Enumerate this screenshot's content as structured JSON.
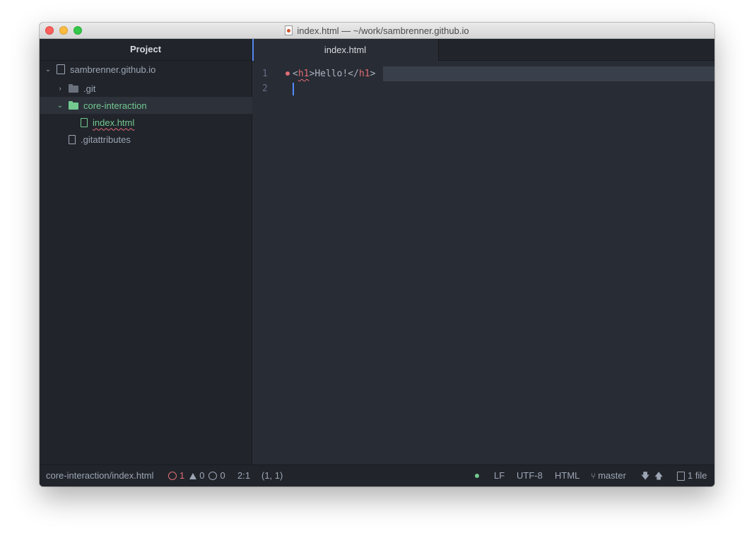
{
  "window": {
    "title": "index.html — ~/work/sambrenner.github.io"
  },
  "sidebar": {
    "header": "Project",
    "root": "sambrenner.github.io",
    "items": [
      {
        "label": ".git",
        "type": "folder",
        "expanded": false
      },
      {
        "label": "core-interaction",
        "type": "folder",
        "expanded": true
      },
      {
        "label": "index.html",
        "type": "file",
        "parent": "core-interaction"
      },
      {
        "label": ".gitattributes",
        "type": "file"
      }
    ]
  },
  "editor": {
    "tab_label": "index.html",
    "lines": [
      {
        "number": "1",
        "open_bracket": "<",
        "open_tag": "h1",
        "close_bracket": ">",
        "text": "Hello!",
        "close_open": "</",
        "close_tag": "h1",
        "close_end": ">"
      },
      {
        "number": "2"
      }
    ]
  },
  "status": {
    "path": "core-interaction/index.html",
    "errors": "1",
    "warnings": "0",
    "infos": "0",
    "cursor": "2:1",
    "selection": "(1, 1)",
    "line_ending": "LF",
    "encoding": "UTF-8",
    "grammar": "HTML",
    "branch": "master",
    "fetch_down": "🡇",
    "push_up": "🡅",
    "files": "1 file"
  },
  "colors": {
    "accent": "#568af2",
    "modified_green": "#73c990",
    "error_red": "#e06c75"
  }
}
